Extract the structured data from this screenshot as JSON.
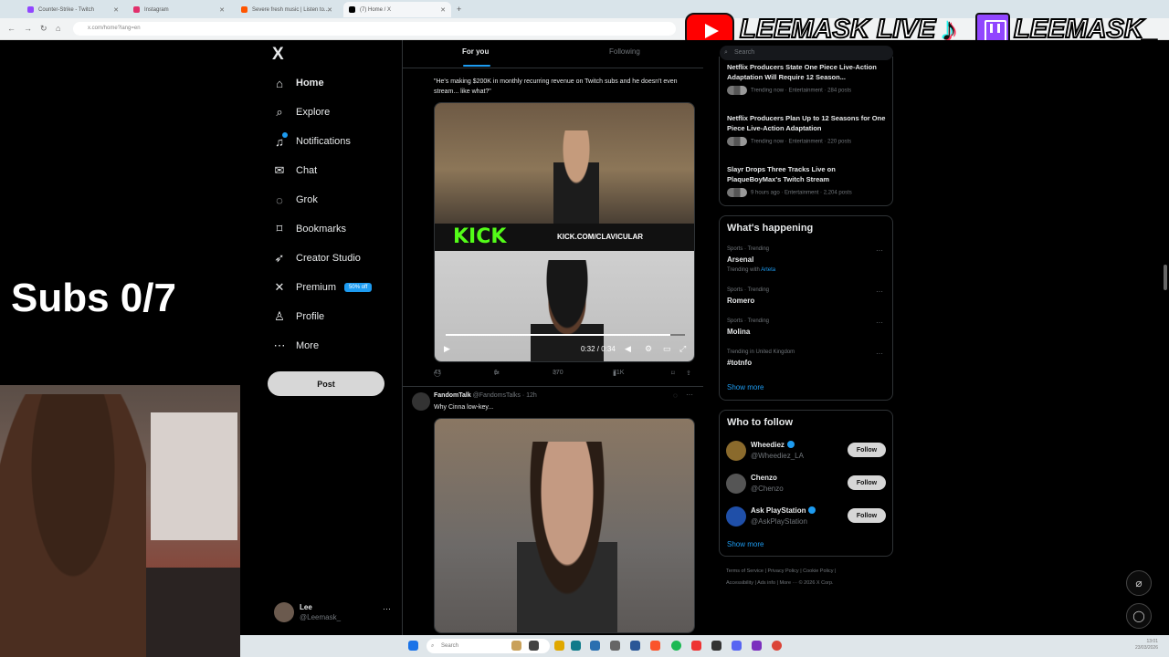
{
  "browser": {
    "tabs": [
      {
        "title": "Counter-Strike - Twitch",
        "color": "#9146ff"
      },
      {
        "title": "Instagram",
        "color": "#e1306c"
      },
      {
        "title": "Severe fresh music | Listen to...",
        "color": "#ff5500"
      },
      {
        "title": "(7) Home / X",
        "color": "#000000"
      }
    ],
    "new_tab": "+",
    "url": "x.com/home?lang=en"
  },
  "overlay": {
    "youtube_label": "LEEMASK LIVE",
    "twitch_label": "LEEMASK_",
    "subs_label": "Subs 0/7"
  },
  "x_sidebar": {
    "logo": "X",
    "nav": [
      {
        "label": "Home",
        "icon": "home-icon",
        "glyph": "⌂"
      },
      {
        "label": "Explore",
        "icon": "search-icon",
        "glyph": "⌕"
      },
      {
        "label": "Notifications",
        "icon": "bell-icon",
        "glyph": "♫"
      },
      {
        "label": "Chat",
        "icon": "mail-icon",
        "glyph": "✉"
      },
      {
        "label": "Grok",
        "icon": "grok-icon",
        "glyph": "◌"
      },
      {
        "label": "Bookmarks",
        "icon": "bookmark-icon",
        "glyph": "⌑"
      },
      {
        "label": "Creator Studio",
        "icon": "rocket-icon",
        "glyph": "➶"
      },
      {
        "label": "Premium",
        "icon": "x-icon",
        "glyph": "✕",
        "badge": "50% off"
      },
      {
        "label": "Profile",
        "icon": "person-icon",
        "glyph": "♙"
      },
      {
        "label": "More",
        "icon": "more-circle-icon",
        "glyph": "⋯"
      }
    ],
    "post_button": "Post",
    "account": {
      "name": "Lee",
      "handle": "@Leemask_",
      "more": "···"
    }
  },
  "feed": {
    "tabs": [
      "For you",
      "Following"
    ],
    "post1": {
      "text": "\"He's making $200K in monthly recurring revenue on Twitch subs and he doesn't even stream... like what?\"",
      "video_overlay_brand": "KICK",
      "video_overlay_url": "KICK.COM/CLAVICULAR",
      "video_time": "0:32 / 0:34",
      "video_progress": 0.94,
      "replies": "43",
      "reposts": "6",
      "likes": "370",
      "views": "71K"
    },
    "post2": {
      "author": "FandomTalk",
      "handle": "@FandomsTalks",
      "time": "· 12h",
      "text": "Why Cinna low-key..."
    }
  },
  "right_sidebar": {
    "search_placeholder": "Search",
    "news": [
      {
        "title": "Netflix Producers State One Piece Live-Action Adaptation Will Require 12 Season...",
        "meta": "Trending now · Entertainment · 284 posts"
      },
      {
        "title": "Netflix Producers Plan Up to 12 Seasons for One Piece Live-Action Adaptation",
        "meta": "Trending now · Entertainment · 220 posts"
      },
      {
        "title": "Slayr Drops Three Tracks Live on PlaqueBoyMax's Twitch Stream",
        "meta": "9 hours ago · Entertainment · 2,204 posts"
      }
    ],
    "whats_happening": {
      "title": "What's happening",
      "items": [
        {
          "category": "Sports · Trending",
          "name": "Arsenal",
          "sub": "Trending with",
          "sub_link": "Arteta"
        },
        {
          "category": "Sports · Trending",
          "name": "Romero",
          "sub": "",
          "sub_link": ""
        },
        {
          "category": "Sports · Trending",
          "name": "Molina",
          "sub": "",
          "sub_link": ""
        },
        {
          "category": "Trending in United Kingdom",
          "name": "#totnfo",
          "sub": "",
          "sub_link": ""
        }
      ],
      "show_more": "Show more"
    },
    "who_to_follow": {
      "title": "Who to follow",
      "accounts": [
        {
          "name": "Wheediez",
          "handle": "@Wheediez_LA",
          "verified": true,
          "button": "Follow",
          "color": "#8a6a2c"
        },
        {
          "name": "Chenzo",
          "handle": "@Chenzo",
          "verified": false,
          "button": "Follow",
          "color": "#555555"
        },
        {
          "name": "Ask PlayStation",
          "handle": "@AskPlayStation",
          "verified": true,
          "button": "Follow",
          "color": "#1f4fa8"
        }
      ],
      "show_more": "Show more"
    },
    "footer_line1": "Terms of Service  |  Privacy Policy  |  Cookie Policy  |",
    "footer_line2": "Accessibility  |  Ads info  |  More ···  © 2026 X Corp."
  },
  "taskbar": {
    "search_placeholder": "Search",
    "clock_time": "13:01",
    "clock_date": "23/03/2026"
  }
}
